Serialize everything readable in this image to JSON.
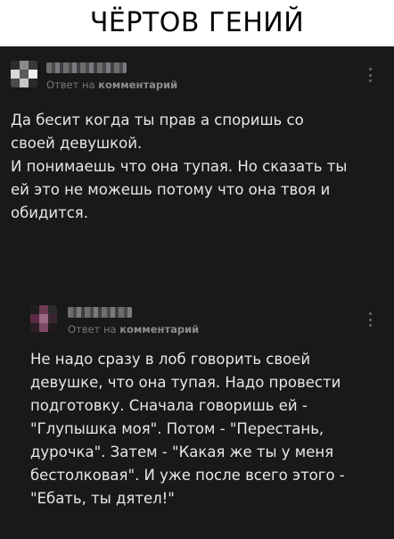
{
  "caption": "ЧЁРТОВ ГЕНИЙ",
  "colors": {
    "background": "#19191a",
    "text": "#e7e7e9",
    "meta": "#76767b"
  },
  "comments": [
    {
      "author_name_redacted": true,
      "reply_prefix": "Ответ на",
      "reply_target": "комментарий",
      "more_icon": "more-vertical-icon",
      "lines": [
        "Да бесит когда ты прав а споришь со",
        "своей девушкой.",
        "И понимаешь что она тупая. Но сказать ты",
        "ей это не можешь потому что она твоя и",
        "обидится."
      ]
    },
    {
      "author_name_redacted": true,
      "reply_prefix": "Ответ на",
      "reply_target": "комментарий",
      "more_icon": "more-vertical-icon",
      "lines": [
        "Не надо сразу в лоб говорить своей",
        "девушке, что она тупая. Надо провести",
        "подготовку. Сначала говоришь ей -",
        "\"Глупышка моя\". Потом - \"Перестань,",
        "дурочка\". Затем - \"Какая же ты у меня",
        "бестолковая\". И уже после всего этого -",
        "\"Ебать, ты дятел!\""
      ]
    }
  ]
}
